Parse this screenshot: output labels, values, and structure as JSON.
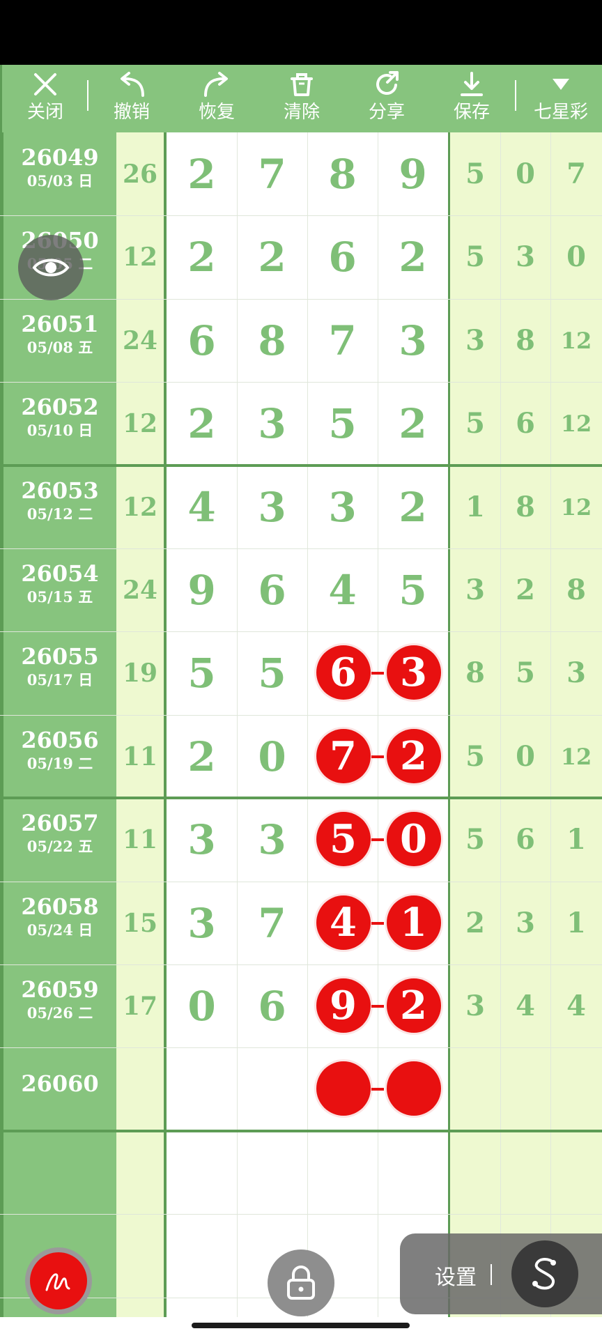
{
  "toolbar": {
    "items": [
      {
        "label": "关闭",
        "icon": "close-icon"
      },
      {
        "label": "撤销",
        "icon": "undo-icon"
      },
      {
        "label": "恢复",
        "icon": "redo-icon"
      },
      {
        "label": "清除",
        "icon": "trash-icon"
      },
      {
        "label": "分享",
        "icon": "share-icon"
      },
      {
        "label": "保存",
        "icon": "download-icon"
      },
      {
        "label": "七星彩",
        "icon": "caret-down-icon"
      }
    ]
  },
  "rows": [
    {
      "id": "26049",
      "date": "05/03 日",
      "sum": "26",
      "main": [
        "2",
        "7",
        "8",
        "9"
      ],
      "right": [
        "5",
        "0",
        "7"
      ]
    },
    {
      "id": "26050",
      "date": "05/05 二",
      "sum": "12",
      "main": [
        "2",
        "2",
        "6",
        "2"
      ],
      "right": [
        "5",
        "3",
        "0"
      ]
    },
    {
      "id": "26051",
      "date": "05/08 五",
      "sum": "24",
      "main": [
        "6",
        "8",
        "7",
        "3"
      ],
      "right": [
        "3",
        "8",
        "12"
      ]
    },
    {
      "id": "26052",
      "date": "05/10 日",
      "sum": "12",
      "main": [
        "2",
        "3",
        "5",
        "2"
      ],
      "right": [
        "5",
        "6",
        "12"
      ]
    },
    {
      "id": "26053",
      "date": "05/12 二",
      "sum": "12",
      "main": [
        "4",
        "3",
        "3",
        "2"
      ],
      "right": [
        "1",
        "8",
        "12"
      ]
    },
    {
      "id": "26054",
      "date": "05/15 五",
      "sum": "24",
      "main": [
        "9",
        "6",
        "4",
        "5"
      ],
      "right": [
        "3",
        "2",
        "8"
      ]
    },
    {
      "id": "26055",
      "date": "05/17 日",
      "sum": "19",
      "main": [
        "5",
        "5",
        "6",
        "3"
      ],
      "right": [
        "8",
        "5",
        "3"
      ]
    },
    {
      "id": "26056",
      "date": "05/19 二",
      "sum": "11",
      "main": [
        "2",
        "0",
        "7",
        "2"
      ],
      "right": [
        "5",
        "0",
        "12"
      ]
    },
    {
      "id": "26057",
      "date": "05/22 五",
      "sum": "11",
      "main": [
        "3",
        "3",
        "5",
        "0"
      ],
      "right": [
        "5",
        "6",
        "1"
      ]
    },
    {
      "id": "26058",
      "date": "05/24 日",
      "sum": "15",
      "main": [
        "3",
        "7",
        "4",
        "1"
      ],
      "right": [
        "2",
        "3",
        "1"
      ]
    },
    {
      "id": "26059",
      "date": "05/26 二",
      "sum": "17",
      "main": [
        "0",
        "6",
        "9",
        "2"
      ],
      "right": [
        "3",
        "4",
        "4"
      ]
    },
    {
      "id": "26060",
      "date": "",
      "sum": "",
      "main": [
        "",
        "",
        "",
        ""
      ],
      "right": [
        "",
        "",
        ""
      ]
    }
  ],
  "highlight_from_row": 6,
  "settings": {
    "label": "设置"
  },
  "colors": {
    "green": "#87c47e",
    "dark_green": "#5d9c55",
    "pale": "#eef9d0",
    "digit": "#7fbf77",
    "ball": "#e81010"
  }
}
